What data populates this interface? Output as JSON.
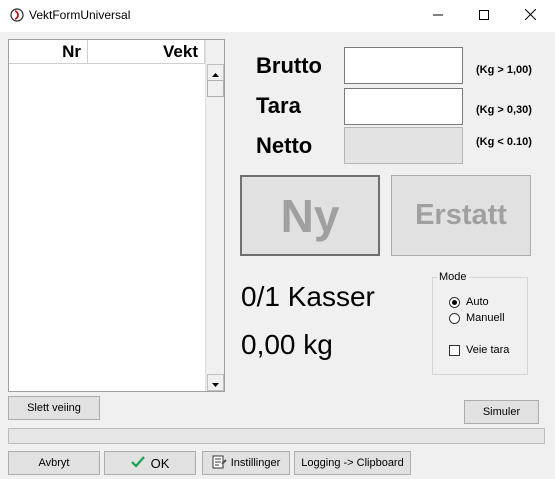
{
  "window": {
    "title": "VektFormUniversal"
  },
  "list": {
    "columns": [
      "Nr",
      "Vekt"
    ],
    "rows": []
  },
  "fields": {
    "brutto": {
      "label": "Brutto",
      "value": "",
      "hint": "(Kg > 1,00)"
    },
    "tara": {
      "label": "Tara",
      "value": "",
      "hint": "(Kg > 0,30)"
    },
    "netto": {
      "label": "Netto",
      "value": "",
      "hint": "(Kg < 0.10)"
    }
  },
  "actions": {
    "ny_label": "Ny",
    "erstatt_label": "Erstatt"
  },
  "summary": {
    "count_text": "0/1 Kasser",
    "weight_text": "0,00 kg"
  },
  "mode": {
    "legend": "Mode",
    "options": [
      {
        "label": "Auto",
        "selected": true
      },
      {
        "label": "Manuell",
        "selected": false
      }
    ],
    "veie_tara": {
      "label": "Veie tara",
      "checked": false
    }
  },
  "buttons": {
    "slett": "Slett veiing",
    "simuler": "Simuler",
    "avbryt": "Avbryt",
    "ok": "OK",
    "instillinger": "Instillinger",
    "logging": "Logging -> Clipboard"
  },
  "colors": {
    "ok_check": "#18a050",
    "disabled_text": "#a0a0a0"
  },
  "icons": [
    "app-icon",
    "minimize-icon",
    "maximize-icon",
    "close-icon",
    "scroll-up-icon",
    "scroll-down-icon",
    "checkmark-icon",
    "settings-icon"
  ]
}
